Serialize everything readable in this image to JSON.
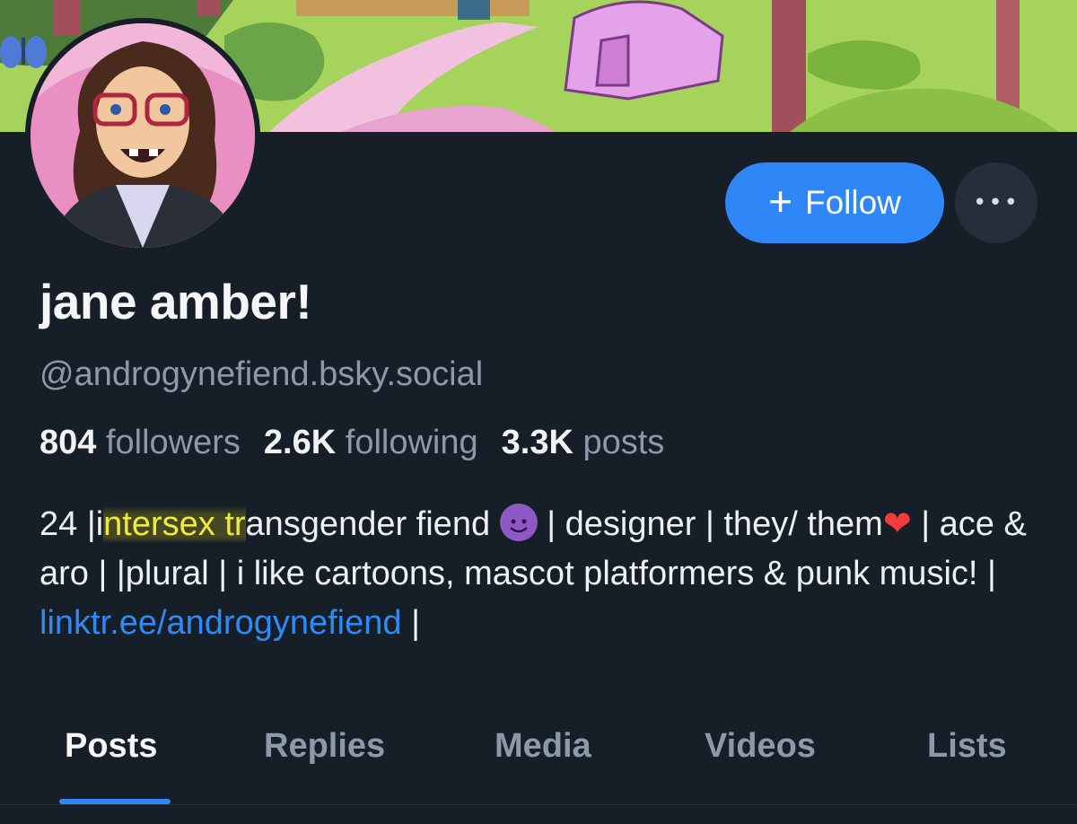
{
  "profile": {
    "display_name": "jane amber!",
    "handle": "@androgynefiend.bsky.social"
  },
  "actions": {
    "follow_plus": "+",
    "follow_label": "Follow",
    "more_label": "•••"
  },
  "stats": {
    "followers_count": "804",
    "followers_label": "followers",
    "following_count": "2.6K",
    "following_label": "following",
    "posts_count": "3.3K",
    "posts_label": "posts"
  },
  "bio": {
    "part1": "24 |i",
    "highlight": "ntersex tr",
    "part2": "ansgender fiend ",
    "emoji_devil": "devil-emoji",
    "part3": " | designer | they/ them",
    "heart": "❤",
    "part4": " | ace & aro | |plural | i like cartoons, mascot platformers & punk music! | ",
    "link": "linktr.ee/androgynefiend",
    "part5": " |"
  },
  "tabs": [
    {
      "label": "Posts",
      "active": true
    },
    {
      "label": "Replies",
      "active": false
    },
    {
      "label": "Media",
      "active": false
    },
    {
      "label": "Videos",
      "active": false
    },
    {
      "label": "Lists",
      "active": false
    }
  ],
  "colors": {
    "background": "#161e27",
    "accent": "#2f86f6",
    "muted_text": "#8c99a8",
    "link": "#2f8af5",
    "highlight_text": "#f0ea3a"
  }
}
